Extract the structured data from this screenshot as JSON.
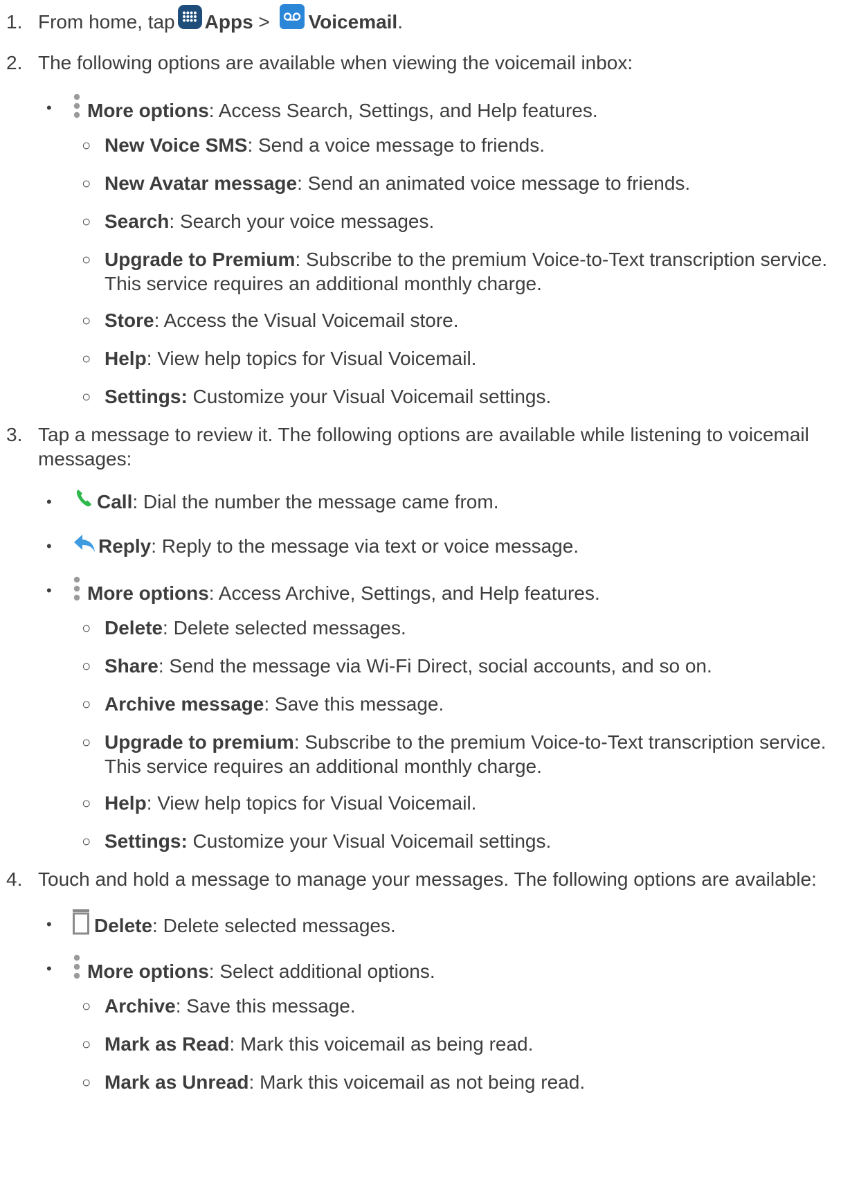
{
  "steps": [
    {
      "num": "1.",
      "text_a": "From home, tap ",
      "apps_icon": "apps-grid-icon",
      "apps": "Apps",
      "sep": " > ",
      "vm_icon": "voicemail-icon",
      "voicemail": "Voicemail",
      "end": "."
    },
    {
      "num": "2.",
      "text": "The following options are available when viewing the voicemail inbox:"
    },
    {
      "num": "3.",
      "text_1": "Tap a message to review it. The following options are available while listening to voicemail",
      "text_2": "messages:"
    },
    {
      "num": "4.",
      "text": "Touch and hold a message to manage your messages. The following options are available:"
    }
  ],
  "bullet_symbol": "•",
  "sub_bullet_symbol": "○",
  "inbox_more": {
    "icon": "more-options-icon",
    "label": "More options",
    "desc": ": Access Search, Settings, and Help features."
  },
  "inbox_items": [
    {
      "label": "New Voice SMS",
      "desc": ": Send a voice message to friends."
    },
    {
      "label": "New Avatar message",
      "desc": ": Send an animated voice message to friends."
    },
    {
      "label": "Search",
      "desc": ": Search your voice messages."
    },
    {
      "label": "Upgrade to Premium",
      "desc": ": Subscribe to the premium Voice-to-Text transcription service.",
      "desc_2": "This service requires an additional monthly charge."
    },
    {
      "label": "Store",
      "desc": ": Access the Visual Voicemail store."
    },
    {
      "label": "Help",
      "desc": ": View help topics for Visual Voicemail."
    },
    {
      "label": "Settings:",
      "desc": " Customize your Visual Voicemail settings."
    }
  ],
  "review_call": {
    "icon": "phone-icon",
    "label": "Call",
    "desc": ": Dial the number the message came from."
  },
  "review_reply": {
    "icon": "reply-icon",
    "label": "Reply",
    "desc": ": Reply to the message via text or voice message."
  },
  "review_more": {
    "icon": "more-options-icon",
    "label": "More options",
    "desc": ": Access Archive, Settings, and Help features."
  },
  "review_items": [
    {
      "label": "Delete",
      "desc": ": Delete selected messages."
    },
    {
      "label": "Share",
      "desc": ": Send the message via Wi-Fi Direct, social accounts, and so on."
    },
    {
      "label": "Archive message",
      "desc": ": Save this message."
    },
    {
      "label": "Upgrade to premium",
      "desc": ": Subscribe to the premium Voice-to-Text transcription service.",
      "desc_2": "This service requires an additional monthly charge."
    },
    {
      "label": "Help",
      "desc": ": View help topics for Visual Voicemail."
    },
    {
      "label": "Settings:",
      "desc": " Customize your Visual Voicemail settings."
    }
  ],
  "manage_delete": {
    "icon": "trash-icon",
    "label": "Delete",
    "desc": ": Delete selected messages."
  },
  "manage_more": {
    "icon": "more-options-icon",
    "label": "More options",
    "desc": ": Select additional options."
  },
  "manage_items": [
    {
      "label": "Archive",
      "desc": ": Save this message."
    },
    {
      "label": "Mark as Read",
      "desc": ": Mark this voicemail as being read."
    },
    {
      "label": "Mark as Unread",
      "desc": ": Mark this voicemail as not being read."
    }
  ],
  "colors": {
    "text": "#3d3d3d",
    "apps_icon": "#1e4d7a",
    "voicemail_icon": "#2b86d8",
    "phone": "#2eb84b",
    "reply": "#3e9be0",
    "dots": "#9a9a9a"
  }
}
